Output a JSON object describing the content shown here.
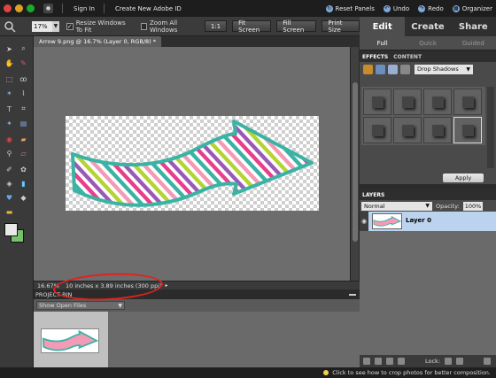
{
  "topbar": {
    "sign_in": "Sign In",
    "create_id": "Create New Adobe ID",
    "reset_panels": "Reset Panels",
    "undo": "Undo",
    "redo": "Redo",
    "organizer": "Organizer"
  },
  "options": {
    "zoom": "17%",
    "resize_windows": "Resize Windows To Fit",
    "zoom_all_windows": "Zoom All Windows",
    "one_to_one": "1:1",
    "fit_screen": "Fit Screen",
    "fill_screen": "Fill Screen",
    "print_size": "Print Size"
  },
  "modes": {
    "edit": "Edit",
    "create": "Create",
    "share": "Share",
    "sub": [
      "Full",
      "Quick",
      "Guided"
    ]
  },
  "document": {
    "tab_title": "Arrow 9.png @ 16.7% (Layer 0, RGB/8) *",
    "zoom_status": "16.67%",
    "dimensions": "10 inches x 3.89 inches (300 ppi)"
  },
  "project_bin": {
    "title": "PROJECT BIN",
    "filter": "Show Open Files"
  },
  "effects": {
    "tabs": [
      "EFFECTS",
      "CONTENT"
    ],
    "category": "Drop Shadows",
    "apply": "Apply"
  },
  "layers": {
    "title": "LAYERS",
    "blend_mode": "Normal",
    "opacity_label": "Opacity:",
    "opacity": "100%",
    "layer_name": "Layer 0",
    "lock_label": "Lock:"
  },
  "hint": "Click to see how to crop photos for better composition.",
  "colors": {
    "accent_annotation": "#e0221e",
    "background_swatch": "#74c06b",
    "foreground_swatch": "#e9e9e9",
    "arrow_outline": "#3ab3a4",
    "stripe_colors": [
      "#3ab3a4",
      "#e83e8c",
      "#9b59b6",
      "#b5d333",
      "#f39ab7"
    ]
  }
}
